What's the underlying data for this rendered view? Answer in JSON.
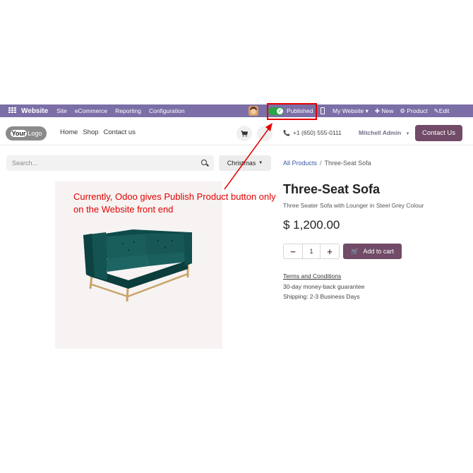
{
  "topbar": {
    "brand": "Website",
    "menu": [
      "Site",
      "eCommerce",
      "Reporting",
      "Configuration"
    ],
    "published_label": "Published",
    "website_selector": "My Website ▾",
    "new_label": "New",
    "product_label": "Product",
    "edit_label": "Edit"
  },
  "header": {
    "logo_your": "Your",
    "logo_rest": "Logo",
    "nav": [
      "Home",
      "Shop",
      "Contact us"
    ],
    "phone": "+1 (650) 555-0111",
    "user": "Mitchell Admin",
    "contact_button": "Contact Us"
  },
  "shop": {
    "search_placeholder": "Search...",
    "pricelist": "Christmas",
    "breadcrumb_root": "All Products",
    "breadcrumb_sep": "/",
    "breadcrumb_current": "Three-Seat Sofa"
  },
  "annotation": {
    "text": "Currently, Odoo gives Publish Product button only on the Website front end",
    "color": "#e30000"
  },
  "product": {
    "name": "Three-Seat Sofa",
    "description": "Three Seater Sofa with Lounger in Steel Grey Colour",
    "price": "$ 1,200.00",
    "quantity": "1",
    "add_to_cart": "Add to cart",
    "terms": "Terms and Conditions",
    "guarantee": "30-day money-back guarantee",
    "shipping": "Shipping: 2-3 Business Days"
  },
  "colors": {
    "admin_bar": "#7c6ea6",
    "primary": "#714b67",
    "published_green": "#28a745",
    "annotation_red": "#e30000"
  }
}
